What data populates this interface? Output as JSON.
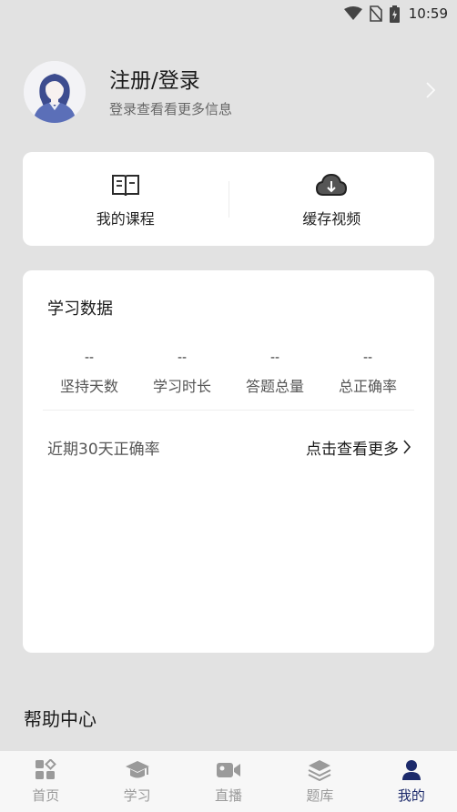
{
  "status_bar": {
    "time": "10:59",
    "icons": [
      "wifi-icon",
      "no-sim-icon",
      "battery-charging-icon"
    ]
  },
  "profile": {
    "title": "注册/登录",
    "subtitle": "登录查看看更多信息",
    "avatar_icon": "avatar-icon",
    "arrow_icon": "chevron-right-icon"
  },
  "quick": {
    "items": [
      {
        "label": "我的课程",
        "icon": "book-icon"
      },
      {
        "label": "缓存视频",
        "icon": "cloud-download-icon"
      }
    ]
  },
  "study": {
    "title": "学习数据",
    "stats": [
      {
        "value": "--",
        "label": "坚持天数"
      },
      {
        "value": "--",
        "label": "学习时长"
      },
      {
        "value": "--",
        "label": "答题总量"
      },
      {
        "value": "--",
        "label": "总正确率"
      }
    ],
    "recent_label": "近期30天正确率",
    "more_label": "点击查看更多"
  },
  "help": {
    "title": "帮助中心"
  },
  "nav": {
    "items": [
      {
        "label": "首页",
        "icon": "home-grid-icon"
      },
      {
        "label": "学习",
        "icon": "graduation-cap-icon"
      },
      {
        "label": "直播",
        "icon": "video-camera-icon"
      },
      {
        "label": "题库",
        "icon": "layers-icon"
      },
      {
        "label": "我的",
        "icon": "user-icon"
      }
    ],
    "active_index": 4
  },
  "colors": {
    "background": "#e2e2e2",
    "card": "#ffffff",
    "accent": "#1c2a6b",
    "nav_inactive": "#9a9a9a",
    "avatar_blue": "#5b6fb8"
  }
}
